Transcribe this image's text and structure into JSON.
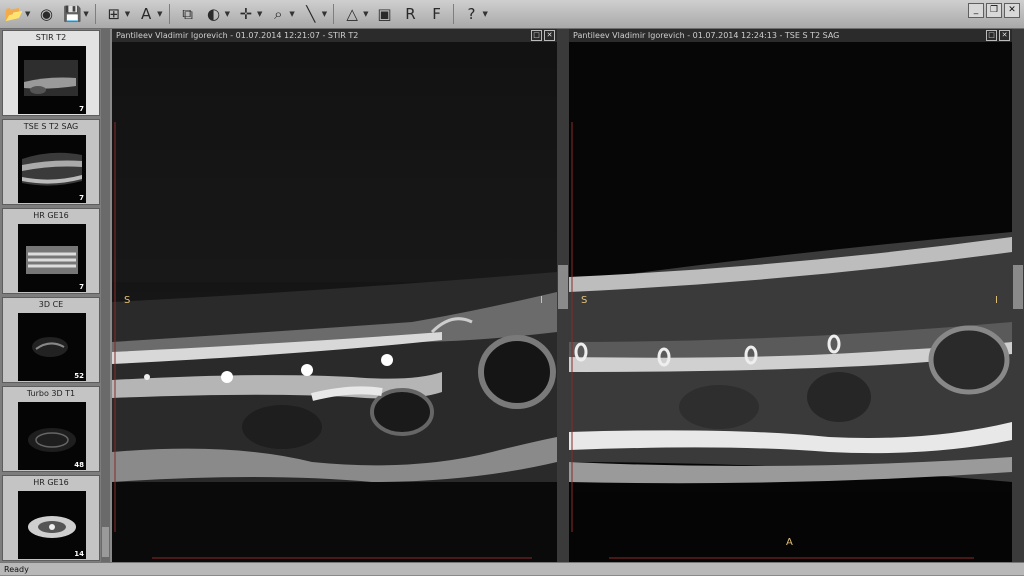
{
  "toolbar": {
    "buttons": [
      {
        "name": "open-folder-icon",
        "glyph": "📂"
      },
      {
        "name": "disc-icon",
        "glyph": "◉"
      },
      {
        "name": "save-icon",
        "glyph": "💾"
      },
      {
        "name": "layout-grid-icon",
        "glyph": "⊞"
      },
      {
        "name": "annotation-text-icon",
        "glyph": "A"
      },
      {
        "name": "series-stack-icon",
        "glyph": "⧉"
      },
      {
        "name": "window-level-icon",
        "glyph": "◐"
      },
      {
        "name": "pan-icon",
        "glyph": "✛"
      },
      {
        "name": "zoom-icon",
        "glyph": "⌕"
      },
      {
        "name": "measure-line-icon",
        "glyph": "╲"
      },
      {
        "name": "reslice-icon",
        "glyph": "△"
      },
      {
        "name": "cine-icon",
        "glyph": "▣"
      },
      {
        "name": "3d-render-icon",
        "glyph": "R"
      },
      {
        "name": "fusion-icon",
        "glyph": "F"
      },
      {
        "name": "help-icon",
        "glyph": "?"
      }
    ],
    "window_controls": [
      "_",
      "❐",
      "✕"
    ]
  },
  "series": [
    {
      "title": "STIR T2",
      "count": "7",
      "active": true
    },
    {
      "title": "TSE S T2 SAG",
      "count": "7",
      "active": false
    },
    {
      "title": "HR GE16",
      "count": "7",
      "active": false
    },
    {
      "title": "3D CE",
      "count": "52",
      "active": false
    },
    {
      "title": "Turbo 3D T1",
      "count": "48",
      "active": false
    },
    {
      "title": "HR GE16",
      "count": "14",
      "active": false
    }
  ],
  "viewports": [
    {
      "header": "Pantileev Vladimir Igorevich - 01.07.2014 12:21:07 - STIR T2",
      "orient_left": "S",
      "orient_right": "I",
      "orient_bottom": ""
    },
    {
      "header": "Pantileev Vladimir Igorevich - 01.07.2014 12:24:13 - TSE S T2 SAG",
      "orient_left": "S",
      "orient_right": "I",
      "orient_bottom": "A"
    }
  ],
  "viewport_buttons": [
    "□",
    "✕"
  ],
  "status": "Ready",
  "colors": {
    "orientation_label": "#e3c27a",
    "viewport_bg": "#000000",
    "ruler": "#8a2a2a"
  }
}
